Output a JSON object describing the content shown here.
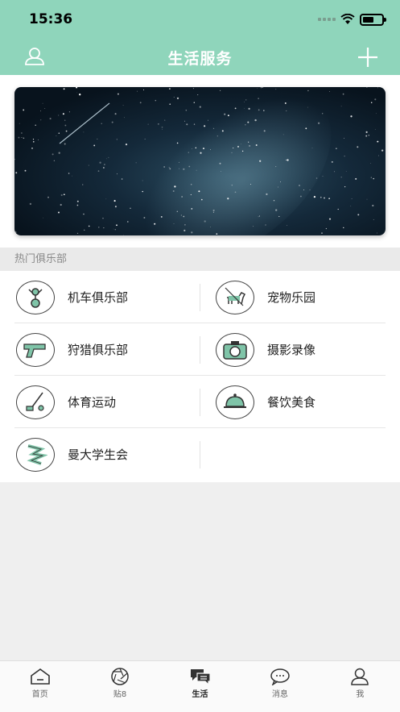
{
  "status_bar": {
    "time": "15:36"
  },
  "nav": {
    "title": "生活服务"
  },
  "section": {
    "title": "热门俱乐部"
  },
  "clubs": [
    {
      "label": "机车俱乐部",
      "icon": "motorcycle-icon"
    },
    {
      "label": "宠物乐园",
      "icon": "dog-icon"
    },
    {
      "label": "狩猎俱乐部",
      "icon": "gun-icon"
    },
    {
      "label": "摄影录像",
      "icon": "camera-icon"
    },
    {
      "label": "体育运动",
      "icon": "golf-icon"
    },
    {
      "label": "餐饮美食",
      "icon": "dining-cloche-icon"
    },
    {
      "label": "曼大学生会",
      "icon": "student-union-icon"
    }
  ],
  "tabs": [
    {
      "label": "首页",
      "icon": "home-icon"
    },
    {
      "label": "贴8",
      "icon": "aperture-icon"
    },
    {
      "label": "生活",
      "icon": "chat-bubbles-icon",
      "active": true
    },
    {
      "label": "消息",
      "icon": "message-bubble-icon"
    },
    {
      "label": "我",
      "icon": "user-icon"
    }
  ],
  "colors": {
    "header": "#8fd5bb",
    "icon_accent": "#7fc4a8"
  }
}
